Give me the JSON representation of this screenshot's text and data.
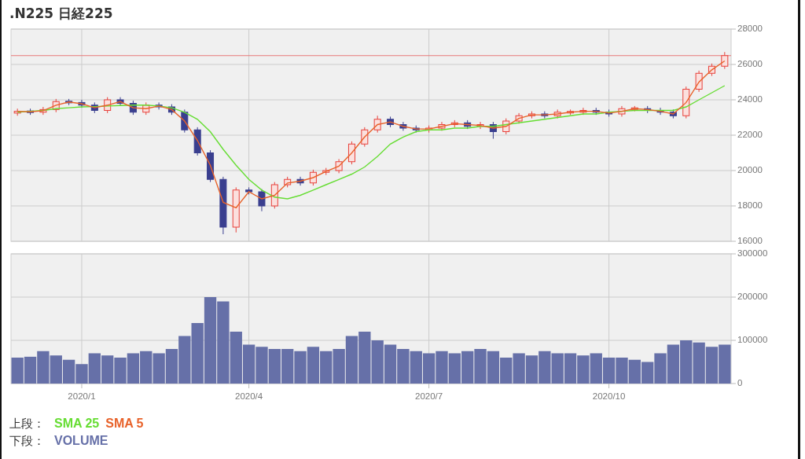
{
  "title": ".N225 日経225",
  "upper": {
    "legend_label": "上段：",
    "chart_data": {
      "type": "candlestick",
      "grid": true,
      "ylim": [
        16000,
        28000
      ],
      "yticks": [
        16000,
        18000,
        20000,
        22000,
        24000,
        26000,
        28000
      ],
      "categories": [
        null,
        null,
        null,
        null,
        null,
        null,
        null,
        null,
        null,
        null,
        null,
        null,
        null,
        null,
        null,
        null,
        null,
        null,
        null,
        null,
        null,
        null,
        null,
        null,
        null,
        null,
        null,
        null,
        null,
        null,
        null,
        null,
        null,
        null,
        null,
        null,
        null,
        null,
        null,
        null,
        null,
        null,
        null,
        null,
        null,
        null,
        null,
        null,
        null,
        null,
        null,
        null,
        null,
        null,
        null,
        null
      ],
      "ohlc": [
        [
          23250,
          23500,
          23100,
          23350
        ],
        [
          23350,
          23500,
          23150,
          23300
        ],
        [
          23300,
          23600,
          23150,
          23450
        ],
        [
          23450,
          24050,
          23300,
          23900
        ],
        [
          23900,
          24050,
          23700,
          23850
        ],
        [
          23850,
          24000,
          23550,
          23700
        ],
        [
          23700,
          23850,
          23250,
          23400
        ],
        [
          23400,
          24150,
          23250,
          24000
        ],
        [
          24000,
          24150,
          23650,
          23800
        ],
        [
          23800,
          23950,
          23150,
          23300
        ],
        [
          23300,
          23850,
          23150,
          23700
        ],
        [
          23700,
          23850,
          23450,
          23600
        ],
        [
          23600,
          23750,
          23150,
          23300
        ],
        [
          23300,
          23450,
          22150,
          22300
        ],
        [
          22300,
          22450,
          20850,
          21000
        ],
        [
          21000,
          21150,
          19350,
          19500
        ],
        [
          19500,
          19650,
          16400,
          16800
        ],
        [
          16800,
          19050,
          16500,
          18900
        ],
        [
          18900,
          19050,
          18650,
          18800
        ],
        [
          18800,
          18950,
          17700,
          18000
        ],
        [
          18000,
          19350,
          17850,
          19200
        ],
        [
          19200,
          19650,
          19050,
          19500
        ],
        [
          19500,
          19650,
          19150,
          19300
        ],
        [
          19300,
          20050,
          19150,
          19900
        ],
        [
          19900,
          20150,
          19750,
          20000
        ],
        [
          20000,
          20650,
          19850,
          20500
        ],
        [
          20500,
          21650,
          20350,
          21500
        ],
        [
          21500,
          22450,
          21350,
          22300
        ],
        [
          22300,
          23100,
          22150,
          22900
        ],
        [
          22900,
          23050,
          22450,
          22600
        ],
        [
          22600,
          22750,
          22250,
          22400
        ],
        [
          22400,
          22550,
          22150,
          22300
        ],
        [
          22300,
          22550,
          22150,
          22400
        ],
        [
          22400,
          22750,
          22250,
          22600
        ],
        [
          22600,
          22850,
          22450,
          22700
        ],
        [
          22700,
          22850,
          22350,
          22500
        ],
        [
          22500,
          22750,
          22350,
          22600
        ],
        [
          22600,
          22750,
          21800,
          22200
        ],
        [
          22200,
          22950,
          22050,
          22800
        ],
        [
          22800,
          23250,
          22650,
          23100
        ],
        [
          23100,
          23350,
          22950,
          23200
        ],
        [
          23200,
          23350,
          22950,
          23100
        ],
        [
          23100,
          23450,
          22950,
          23300
        ],
        [
          23300,
          23450,
          23150,
          23300
        ],
        [
          23300,
          23550,
          23150,
          23400
        ],
        [
          23400,
          23550,
          23150,
          23300
        ],
        [
          23300,
          23450,
          23050,
          23200
        ],
        [
          23200,
          23650,
          23050,
          23500
        ],
        [
          23500,
          23650,
          23350,
          23500
        ],
        [
          23500,
          23650,
          23250,
          23400
        ],
        [
          23400,
          23550,
          23150,
          23300
        ],
        [
          23300,
          23450,
          22950,
          23100
        ],
        [
          23100,
          24750,
          22950,
          24600
        ],
        [
          24600,
          25650,
          24450,
          25500
        ],
        [
          25500,
          26050,
          25350,
          25900
        ],
        [
          25900,
          26700,
          25750,
          26500
        ]
      ],
      "ref_lines": [
        {
          "axis": "y",
          "value": 26500
        }
      ]
    },
    "overlay": {
      "chart_data": {
        "type": "line",
        "ylim": [
          16000,
          28000
        ],
        "categories": [
          null,
          null,
          null,
          null,
          null,
          null,
          null,
          null,
          null,
          null,
          null,
          null,
          null,
          null,
          null,
          null,
          null,
          null,
          null,
          null,
          null,
          null,
          null,
          null,
          null,
          null,
          null,
          null,
          null,
          null,
          null,
          null,
          null,
          null,
          null,
          null,
          null,
          null,
          null,
          null,
          null,
          null,
          null,
          null,
          null,
          null,
          null,
          null,
          null,
          null,
          null,
          null,
          null,
          null,
          null,
          null
        ],
        "series": [
          {
            "name": "SMA 25",
            "color": "#66dd33",
            "values": [
              23300,
              23350,
              23400,
              23500,
              23550,
              23600,
              23620,
              23650,
              23680,
              23700,
              23700,
              23650,
              23550,
              23300,
              22900,
              22200,
              21200,
              20300,
              19500,
              18900,
              18500,
              18400,
              18600,
              18900,
              19200,
              19500,
              19800,
              20200,
              20800,
              21500,
              21900,
              22200,
              22300,
              22300,
              22400,
              22400,
              22500,
              22500,
              22600,
              22700,
              22800,
              22900,
              23000,
              23100,
              23200,
              23200,
              23300,
              23350,
              23400,
              23400,
              23400,
              23400,
              23600,
              24000,
              24400,
              24800
            ]
          },
          {
            "name": "SMA 5",
            "color": "#e8622a",
            "values": [
              23350,
              23320,
              23380,
              23700,
              23880,
              23780,
              23550,
              23700,
              23900,
              23550,
              23500,
              23650,
              23450,
              22800,
              21700,
              20300,
              18200,
              17900,
              18800,
              18400,
              18600,
              19300,
              19400,
              19600,
              19950,
              20250,
              21000,
              21900,
              22600,
              22750,
              22500,
              22350,
              22350,
              22500,
              22650,
              22600,
              22550,
              22400,
              22500,
              22950,
              23150,
              23150,
              23200,
              23300,
              23350,
              23350,
              23250,
              23350,
              23500,
              23450,
              23350,
              23200,
              23850,
              25000,
              25700,
              26200
            ]
          }
        ]
      }
    }
  },
  "lower": {
    "legend_label": "下段：",
    "chart_data": {
      "type": "bar",
      "grid": true,
      "ylim": [
        0,
        300000
      ],
      "yticks": [
        0,
        100000,
        200000,
        300000
      ],
      "categories": [
        null,
        null,
        null,
        null,
        null,
        "2020/1",
        null,
        null,
        null,
        null,
        null,
        null,
        null,
        null,
        null,
        null,
        null,
        null,
        "2020/4",
        null,
        null,
        null,
        null,
        null,
        null,
        null,
        null,
        null,
        null,
        null,
        null,
        null,
        "2020/7",
        null,
        null,
        null,
        null,
        null,
        null,
        null,
        null,
        null,
        null,
        null,
        null,
        null,
        "2020/10",
        null,
        null,
        null,
        null,
        null,
        null,
        null,
        null,
        null
      ],
      "series": [
        {
          "name": "VOLUME",
          "color": "#6670a8",
          "values": [
            60000,
            62000,
            75000,
            65000,
            55000,
            45000,
            70000,
            65000,
            60000,
            70000,
            75000,
            70000,
            80000,
            110000,
            140000,
            200000,
            190000,
            120000,
            90000,
            85000,
            80000,
            80000,
            75000,
            85000,
            75000,
            80000,
            110000,
            120000,
            100000,
            90000,
            80000,
            75000,
            70000,
            75000,
            70000,
            75000,
            80000,
            75000,
            60000,
            70000,
            65000,
            75000,
            70000,
            70000,
            65000,
            70000,
            60000,
            60000,
            55000,
            50000,
            70000,
            90000,
            100000,
            95000,
            85000,
            90000
          ]
        }
      ]
    }
  }
}
